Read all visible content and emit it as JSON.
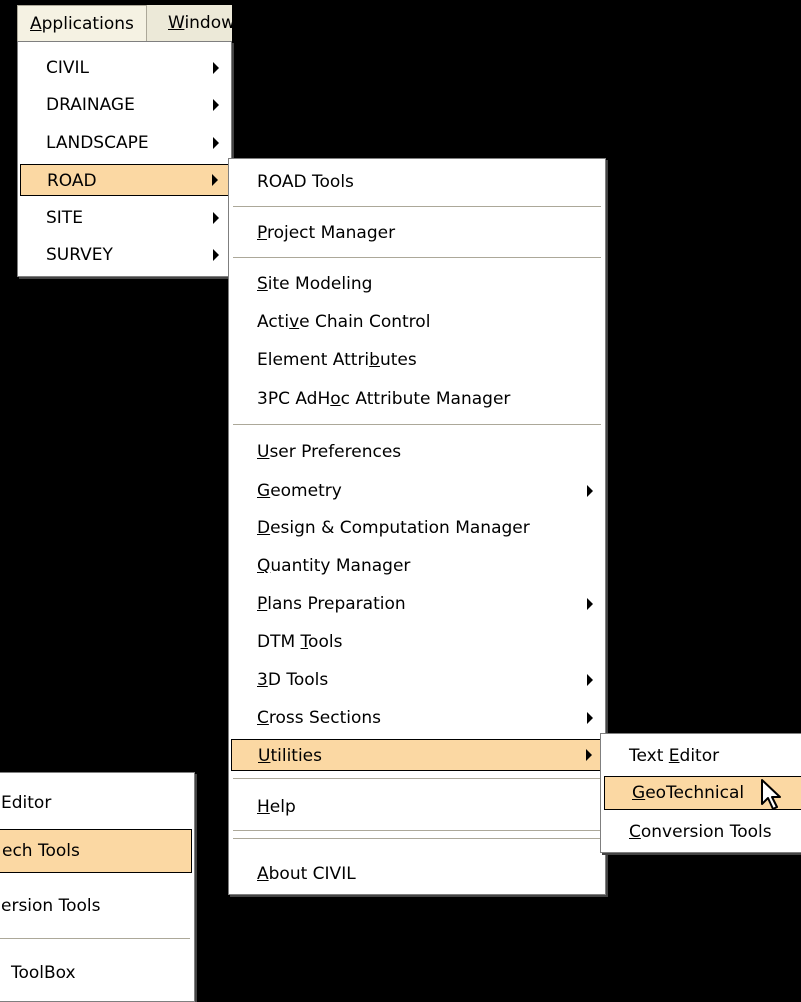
{
  "menubar": {
    "applications": "Applications",
    "window": "Window"
  },
  "applications_menu": {
    "items": [
      {
        "label": "CIVIL"
      },
      {
        "label": "DRAINAGE"
      },
      {
        "label": "LANDSCAPE"
      },
      {
        "label": "ROAD"
      },
      {
        "label": "SITE"
      },
      {
        "label": "SURVEY"
      }
    ]
  },
  "road_menu": {
    "road_tools": "ROAD Tools",
    "project_manager": {
      "pre": "",
      "u": "P",
      "post": "roject Manager"
    },
    "site_modeling": {
      "pre": "",
      "u": "S",
      "post": "ite Modeling"
    },
    "active_chain": {
      "pre": "Acti",
      "u": "v",
      "post": "e Chain Control"
    },
    "element_attr": {
      "pre": "Element Attri",
      "u": "b",
      "post": "utes"
    },
    "adhoc": {
      "pre": "3PC AdH",
      "u": "o",
      "post": "c Attribute Manager"
    },
    "user_prefs": {
      "pre": "",
      "u": "U",
      "post": "ser Preferences"
    },
    "geometry": {
      "pre": "",
      "u": "G",
      "post": "eometry"
    },
    "design_comp": {
      "pre": "",
      "u": "D",
      "post": "esign & Computation Manager"
    },
    "quantity": {
      "pre": "",
      "u": "Q",
      "post": "uantity Manager"
    },
    "plans": {
      "pre": "",
      "u": "P",
      "post": "lans Preparation"
    },
    "dtm": {
      "pre": "DTM ",
      "u": "T",
      "post": "ools"
    },
    "tools3d": {
      "pre": "",
      "u": "3",
      "post": "D Tools"
    },
    "cross": {
      "pre": "",
      "u": "C",
      "post": "ross Sections"
    },
    "utilities": {
      "pre": "",
      "u": "U",
      "post": "tilities"
    },
    "help": {
      "pre": "",
      "u": "H",
      "post": "elp"
    },
    "about": {
      "pre": "",
      "u": "A",
      "post": "bout CIVIL"
    }
  },
  "utilities_menu": {
    "text_editor": {
      "pre": "Text ",
      "u": "E",
      "post": "ditor"
    },
    "geotechnical": {
      "pre": "",
      "u": "G",
      "post": "eoTechnical"
    },
    "conversion": {
      "pre": "",
      "u": "C",
      "post": "onversion Tools"
    }
  },
  "bg_menu": {
    "editor": "Editor",
    "geotech_tools": "ech Tools",
    "conversion": "ersion Tools",
    "toolbox": "ToolBox"
  }
}
